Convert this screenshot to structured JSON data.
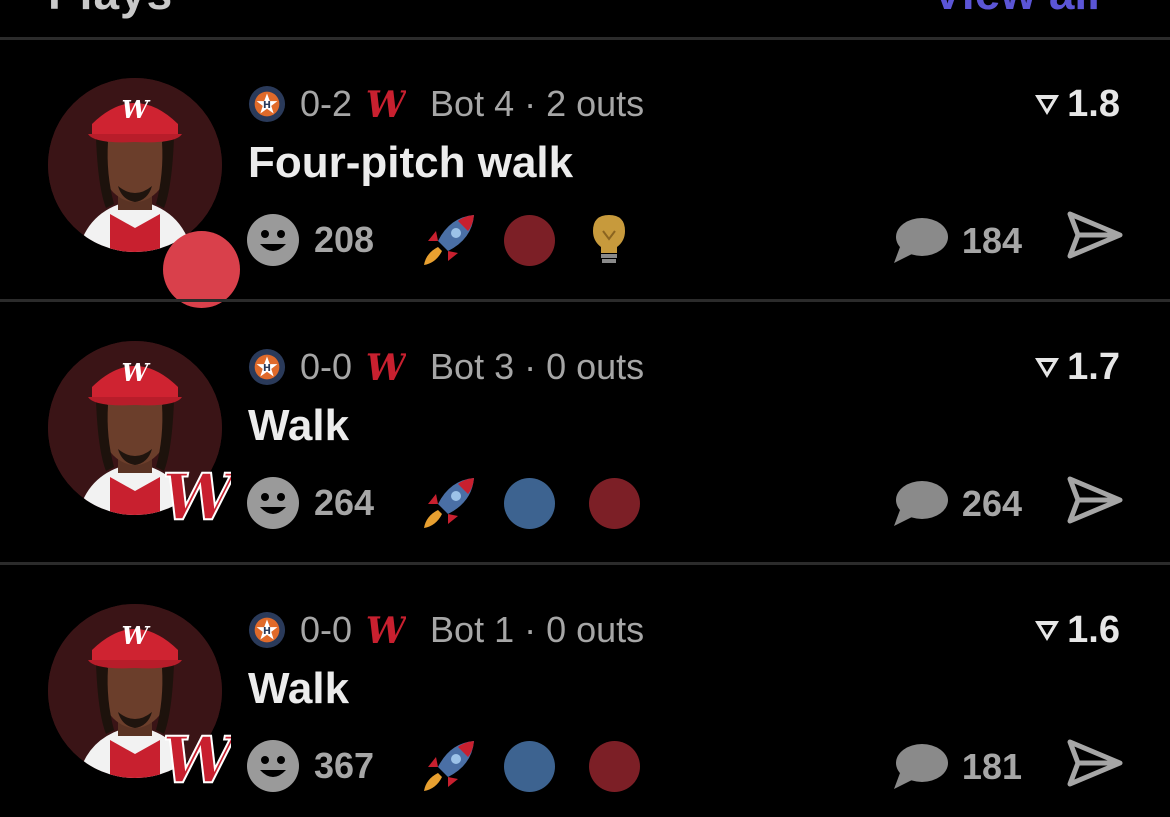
{
  "header": {
    "section_title": "Plays",
    "view_all_label": "View all"
  },
  "colors": {
    "background": "#000000",
    "divider": "#2b2b2b",
    "muted_text": "#a6a6a6",
    "accent": "#5b55d6",
    "status_red": "#d9404b",
    "dot_blue": "#3d6390",
    "dot_red": "#7c1f26"
  },
  "plays": [
    {
      "count": "0-2",
      "inning": "Bot 4 · 2 outs",
      "title": "Four-pitch walk",
      "rating": "1.8",
      "reaction_count": "208",
      "comment_count": "184",
      "avatar_badge": "status-dot",
      "reaction_icons": [
        "rocket-icon",
        "red-dot-icon",
        "lightbulb-icon"
      ]
    },
    {
      "count": "0-0",
      "inning": "Bot 3 · 0 outs",
      "title": "Walk",
      "rating": "1.7",
      "reaction_count": "264",
      "comment_count": "264",
      "avatar_badge": "team-logo",
      "reaction_icons": [
        "rocket-icon",
        "blue-dot-icon",
        "red-dot-icon"
      ]
    },
    {
      "count": "0-0",
      "inning": "Bot 1 · 0 outs",
      "title": "Walk",
      "rating": "1.6",
      "reaction_count": "367",
      "comment_count": "181",
      "avatar_badge": "team-logo",
      "reaction_icons": [
        "rocket-icon",
        "blue-dot-icon",
        "red-dot-icon"
      ]
    }
  ]
}
